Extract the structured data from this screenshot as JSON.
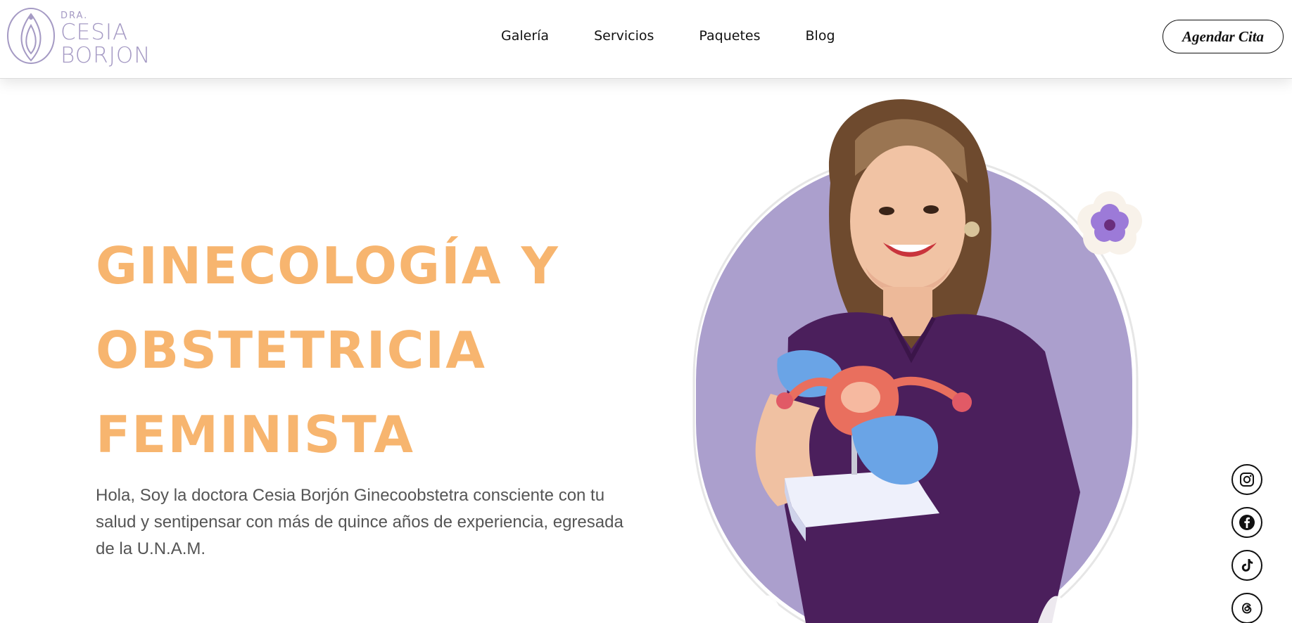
{
  "brand": {
    "prefix": "DRA.",
    "name_line1": "CESIA",
    "name_line2": "BORJON",
    "color": "#a59ac4"
  },
  "nav": {
    "items": [
      {
        "label": "Galería"
      },
      {
        "label": "Servicios"
      },
      {
        "label": "Paquetes"
      },
      {
        "label": "Blog"
      }
    ]
  },
  "header": {
    "cta_label": "Agendar Cita"
  },
  "hero": {
    "title_lines": [
      "GINECOLOGÍA Y",
      "OBSTETRICIA",
      "FEMINISTA"
    ],
    "title_color": "#f7b56f",
    "description": "Hola, Soy la doctora Cesia Borjón Ginecoobstetra consciente con tu salud y sentipensar con más de quince años de experiencia, egresada de la U.N.A.M.",
    "accent_color": "#ab9fcd",
    "scrub_color": "#4b1f5c"
  },
  "social": {
    "icons": [
      "instagram-icon",
      "facebook-icon",
      "tiktok-icon",
      "threads-icon"
    ]
  }
}
